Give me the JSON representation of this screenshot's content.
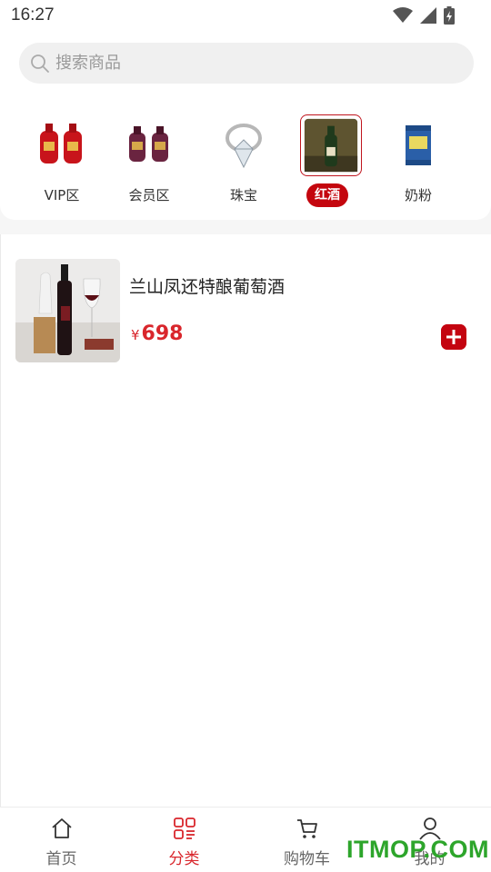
{
  "status_bar": {
    "time": "16:27"
  },
  "search": {
    "placeholder": "搜索商品"
  },
  "categories": [
    {
      "label": "VIP区",
      "icon": "red-liquor-bottles",
      "active": false
    },
    {
      "label": "会员区",
      "icon": "purple-liquor-bottles",
      "active": false
    },
    {
      "label": "珠宝",
      "icon": "diamond-ring",
      "active": false
    },
    {
      "label": "红酒",
      "icon": "wine-bottle",
      "active": true
    },
    {
      "label": "奶粉",
      "icon": "milk-powder-can",
      "active": false
    }
  ],
  "products": [
    {
      "name": "兰山凤还特酿葡萄酒",
      "currency": "¥",
      "price": "698"
    }
  ],
  "tabs": [
    {
      "label": "首页",
      "icon": "home-icon",
      "active": false
    },
    {
      "label": "分类",
      "icon": "category-icon",
      "active": true
    },
    {
      "label": "购物车",
      "icon": "cart-icon",
      "active": false
    },
    {
      "label": "我的",
      "icon": "user-icon",
      "active": false
    }
  ],
  "watermark": "ITMOP.COM",
  "colors": {
    "accent": "#c4060e",
    "price": "#d9262c",
    "watermark": "#2da52b"
  }
}
